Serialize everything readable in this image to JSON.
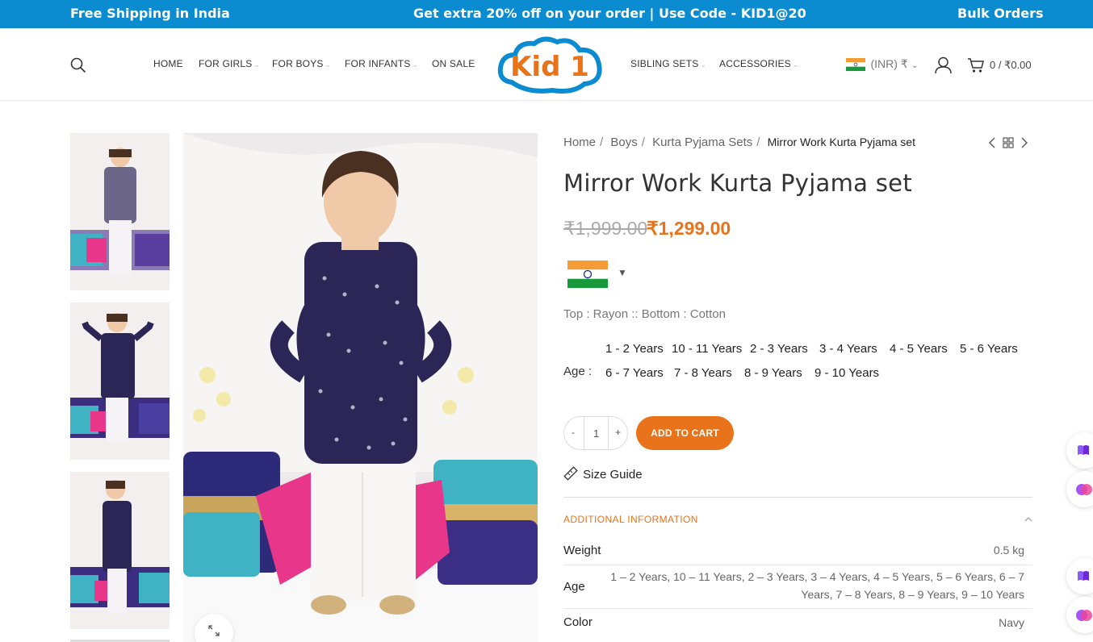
{
  "topbar": {
    "left": "Free Shipping in India",
    "center": "Get extra 20% off on your order | Use Code - KID1@20",
    "right": "Bulk Orders"
  },
  "nav": {
    "left": [
      "HOME",
      "FOR GIRLS",
      "FOR BOYS",
      "FOR INFANTS",
      "ON SALE"
    ],
    "right": [
      "SIBLING SETS",
      "ACCESSORIES"
    ],
    "logo_text": "Kid 1",
    "currency": "(INR) ₹",
    "cart": "0 / ₹0.00"
  },
  "breadcrumb": [
    "Home",
    "Boys",
    "Kurta Pyjama Sets"
  ],
  "breadcrumb_current": "Mirror Work Kurta Pyjama set",
  "product": {
    "title": "Mirror Work Kurta Pyjama set",
    "old_price": "₹1,999.00",
    "new_price": "₹1,299.00",
    "material": "Top : Rayon :: Bottom : Cotton",
    "age_label": "Age",
    "ages_row1": [
      "1 - 2 Years",
      "10 - 11 Years",
      "2 - 3 Years",
      "3 - 4 Years",
      "4 - 5 Years",
      "5 - 6 Years"
    ],
    "ages_row2": [
      "6 - 7 Years",
      "7 - 8 Years",
      "8 - 9 Years",
      "9 - 10 Years"
    ],
    "qty_minus": "-",
    "qty": "1",
    "qty_plus": "+",
    "add_to_cart": "ADD TO CART",
    "size_guide": "Size Guide"
  },
  "info": {
    "heading": "ADDITIONAL INFORMATION",
    "weight_label": "Weight",
    "weight_value": "0.5 kg",
    "age_label": "Age",
    "age_value_1": "1 – 2 Years, 10 – 11 Years, 2 – 3 Years, 3 – 4 Years, 4 – 5 Years, 5 – 6 Years, 6 – 7",
    "age_value_2": "Years, 7 – 8 Years, 8 – 9 Years, 9 – 10 Years",
    "color_label": "Color",
    "color_value": "Navy"
  },
  "colors": {
    "brand_blue": "#0c8cd0",
    "accent_orange": "#e8731b",
    "kurta_navy": "#2b2656"
  },
  "icons": [
    "search-icon",
    "user-icon",
    "cart-icon",
    "india-flag-icon",
    "chevron-left-icon",
    "grid-icon",
    "chevron-right-icon",
    "expand-icon",
    "ruler-icon",
    "chevron-up-icon",
    "book-icon",
    "brain-icon"
  ]
}
